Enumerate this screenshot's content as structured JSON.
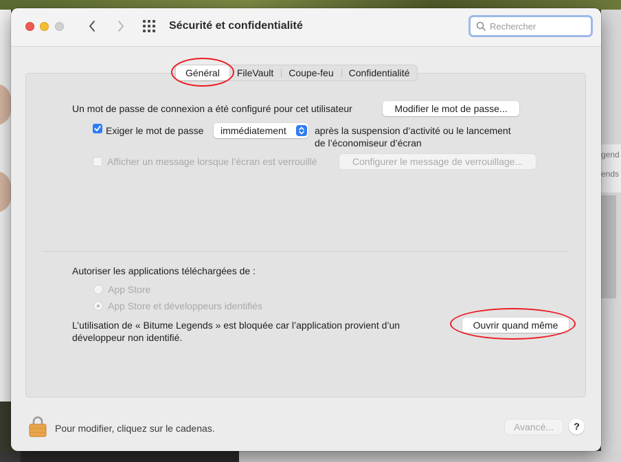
{
  "window": {
    "title": "Sécurité et confidentialité",
    "search_placeholder": "Rechercher"
  },
  "tabs": [
    "Général",
    "FileVault",
    "Coupe-feu",
    "Confidentialité"
  ],
  "active_tab": "Général",
  "general": {
    "password_text": "Un mot de passe de connexion a été configuré pour cet utilisateur",
    "change_password_button": "Modifier le mot de passe...",
    "require_password_label": "Exiger le mot de passe",
    "require_password_checked": true,
    "require_password_delay": "immédiatement",
    "after_text_line1": "après la suspension d’activité ou le lancement",
    "after_text_line2": "de l’économiseur d’écran",
    "show_message_label": "Afficher un message lorsque l’écran est verrouillé",
    "show_message_checked": false,
    "configure_message_button": "Configurer le message de verrouillage...",
    "allow_apps_label": "Autoriser les applications téléchargées de :",
    "radio_app_store": "App Store",
    "radio_app_store_devs": "App Store et développeurs identifiés",
    "selected_radio": "App Store et développeurs identifiés",
    "blocked_line1": "L’utilisation de « Bitume Legends » est bloquée car l’application provient d’un",
    "blocked_line2": "développeur non identifié.",
    "open_anyway_button": "Ouvrir quand même"
  },
  "footer": {
    "lock_text": "Pour modifier, cliquez sur le cadenas.",
    "advanced_button": "Avancé...",
    "help_button": "?"
  },
  "background": {
    "right_card_line1": "gend",
    "right_card_line2": "ends"
  },
  "colors": {
    "accent": "#2f7cf6",
    "annotation_red": "#ec1c24"
  }
}
